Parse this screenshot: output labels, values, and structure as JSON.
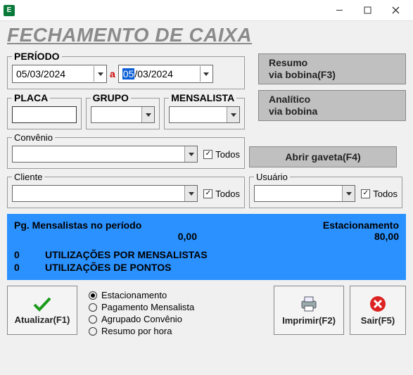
{
  "window": {
    "icon_letter": "E"
  },
  "header": {
    "title": "FECHAMENTO DE CAIXA"
  },
  "periodo": {
    "label": "PERÍODO",
    "from": "05/03/2024",
    "sep": "a",
    "to_day": "05",
    "to_rest": "/03/2024"
  },
  "placa": {
    "label": "PLACA",
    "value": ""
  },
  "grupo": {
    "label": "GRUPO",
    "value": ""
  },
  "mensalista": {
    "label": "MENSALISTA",
    "value": ""
  },
  "side": {
    "resumo_l1": "Resumo",
    "resumo_l2": "via bobina(F3)",
    "anal_l1": "Analítico",
    "anal_l2": "via bobina",
    "abrir": "Abrir gaveta(F4)"
  },
  "convenio": {
    "label": "Convênio",
    "todos": "Todos"
  },
  "cliente": {
    "label": "Cliente",
    "todos": "Todos"
  },
  "usuario": {
    "label": "Usuário",
    "todos": "Todos"
  },
  "blue": {
    "lbl1": "Pg. Mensalistas no período",
    "val1": "0,00",
    "lbl2": "Estacionamento",
    "val2": "80,00",
    "c1": "0",
    "t1": "UTILIZAÇÕES POR MENSALISTAS",
    "c2": "0",
    "t2": "UTILIZAÇÕES DE PONTOS"
  },
  "bottom": {
    "atualizar": "Atualizar(F1)",
    "imprimir": "Imprimir(F2)",
    "sair": "Sair(F5)",
    "radios": {
      "r1": "Estacionamento",
      "r2": "Pagamento Mensalista",
      "r3": "Agrupado Convênio",
      "r4": "Resumo por hora"
    }
  }
}
